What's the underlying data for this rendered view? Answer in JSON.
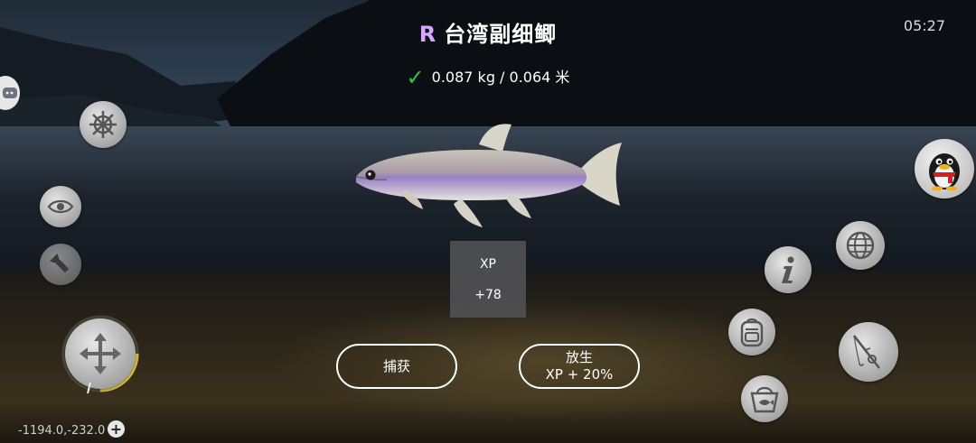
{
  "header": {
    "rarity": "R",
    "fish_name": "台湾副细鲫",
    "clock": "05:27",
    "catch_stats": "0.087 kg / 0.064 米"
  },
  "xp_popup": {
    "label": "XP",
    "value": "+78"
  },
  "actions": {
    "catch_label": "捕获",
    "release_label": "放生",
    "release_bonus": "XP + 20%"
  },
  "status": {
    "coordinates": "-1194.0,-232.0",
    "plus_symbol": "+"
  },
  "colors": {
    "rarity": "#d9a6ff",
    "check": "#34c24a",
    "joystick_arc": "#d9c24a"
  },
  "icons": {
    "left": [
      "chat-icon",
      "helm-icon",
      "eye-icon",
      "flashlight-icon",
      "move-arrows-icon"
    ],
    "right": [
      "penguin-avatar-icon",
      "globe-icon",
      "info-icon",
      "backpack-icon",
      "fishing-rod-icon",
      "fish-basket-icon"
    ]
  }
}
